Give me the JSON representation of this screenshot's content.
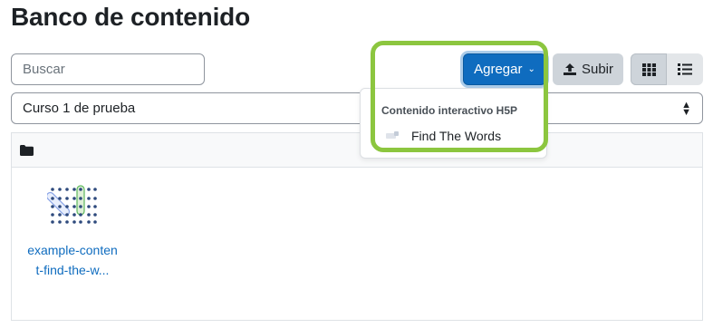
{
  "page": {
    "title": "Banco de contenido"
  },
  "search": {
    "placeholder": "Buscar"
  },
  "toolbar": {
    "add_label": "Agregar",
    "upload_label": "Subir",
    "grid_view_icon": "grid-icon",
    "list_view_icon": "list-icon"
  },
  "course_select": {
    "value": "Curso 1 de prueba"
  },
  "content": {
    "header_icon": "folder-icon",
    "items": [
      {
        "name": "example-content-find-the-w...",
        "icon": "find-the-words-thumbnail"
      }
    ]
  },
  "add_menu": {
    "header": "Contenido interactivo H5P",
    "items": [
      {
        "label": "Find The Words",
        "icon": "h5p-icon"
      }
    ]
  },
  "colors": {
    "primary": "#0f6cbf",
    "secondary": "#ced4da",
    "highlight": "#8cc63f",
    "link": "#0f6cbf"
  }
}
